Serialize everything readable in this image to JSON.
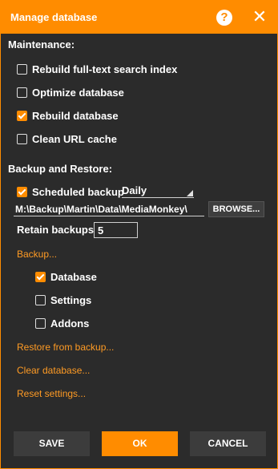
{
  "dialog": {
    "title": "Manage database"
  },
  "maintenance": {
    "heading": "Maintenance:",
    "items": [
      {
        "label": "Rebuild full-text search index",
        "checked": false
      },
      {
        "label": "Optimize database",
        "checked": false
      },
      {
        "label": "Rebuild database",
        "checked": true
      },
      {
        "label": "Clean URL cache",
        "checked": false
      }
    ]
  },
  "backup": {
    "heading": "Backup and Restore:",
    "scheduled_label": "Scheduled backup",
    "scheduled_checked": true,
    "frequency": "Daily",
    "path": "M:\\Backup\\Martin\\Data\\MediaMonkey\\",
    "browse_label": "BROWSE...",
    "retain_label": "Retain backups:",
    "retain_value": "5",
    "backup_link": "Backup...",
    "options": [
      {
        "label": "Database",
        "checked": true
      },
      {
        "label": "Settings",
        "checked": false
      },
      {
        "label": "Addons",
        "checked": false
      }
    ],
    "restore_link": "Restore from backup...",
    "clear_link": "Clear database...",
    "reset_link": "Reset settings..."
  },
  "buttons": {
    "save": "SAVE",
    "ok": "OK",
    "cancel": "CANCEL"
  },
  "colors": {
    "accent": "#ff8c00",
    "link": "#ff9b24",
    "background": "#2b2b2b"
  },
  "icons": {
    "help": "help-icon",
    "close": "close-icon"
  }
}
